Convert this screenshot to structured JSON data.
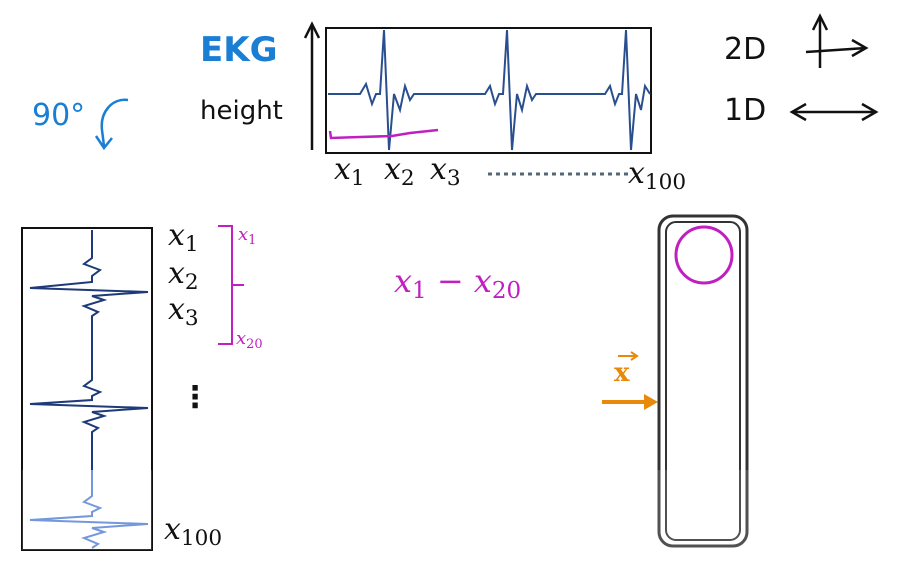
{
  "ekg_title": "EKG",
  "height_label": "height",
  "rotation_label": "90°",
  "label_2d": "2D",
  "label_1d": "1D",
  "x_labels": {
    "x1": {
      "base": "x",
      "sub": "1"
    },
    "x2": {
      "base": "x",
      "sub": "2"
    },
    "x3": {
      "base": "x",
      "sub": "3"
    },
    "x20": {
      "base": "x",
      "sub": "20"
    },
    "x100": {
      "base": "x",
      "sub": "100"
    }
  },
  "range_label": {
    "from_base": "x",
    "from_sub": "1",
    "dash": "−",
    "to_base": "x",
    "to_sub": "20"
  },
  "vector_label": "x",
  "vertical_dots": "⋮",
  "colors": {
    "blue_text": "#1a7fd4",
    "magenta": "#c020c0",
    "signal": "#2a4f8f",
    "orange": "#e8890c"
  }
}
